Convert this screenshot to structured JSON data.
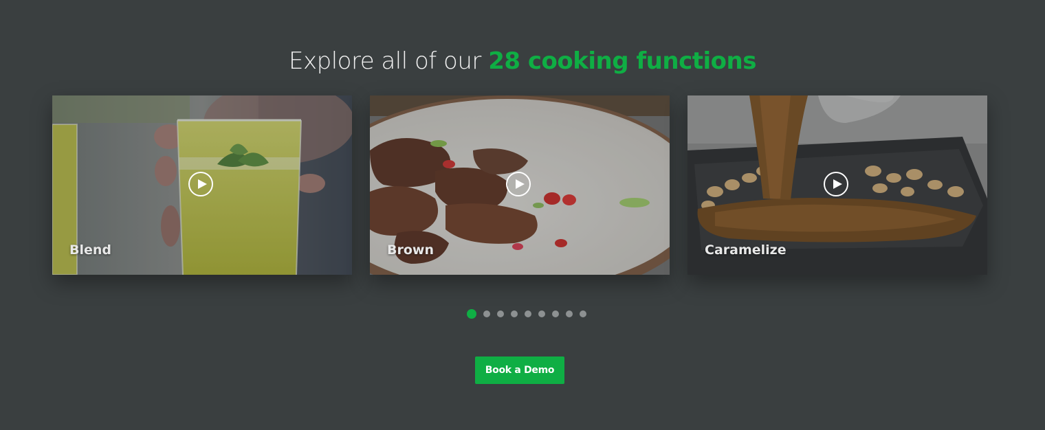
{
  "headline": {
    "prefix": "Explore all of our ",
    "highlight": "28 cooking functions"
  },
  "colors": {
    "background": "#3a3f40",
    "accent": "#0fae44",
    "dot_inactive": "#8d9192"
  },
  "cards": [
    {
      "label": "Blend",
      "icon": "play-icon"
    },
    {
      "label": "Brown",
      "icon": "play-icon"
    },
    {
      "label": "Caramelize",
      "icon": "play-icon"
    }
  ],
  "pagination": {
    "count": 9,
    "active": 1
  },
  "cta": {
    "label": "Book a Demo"
  }
}
